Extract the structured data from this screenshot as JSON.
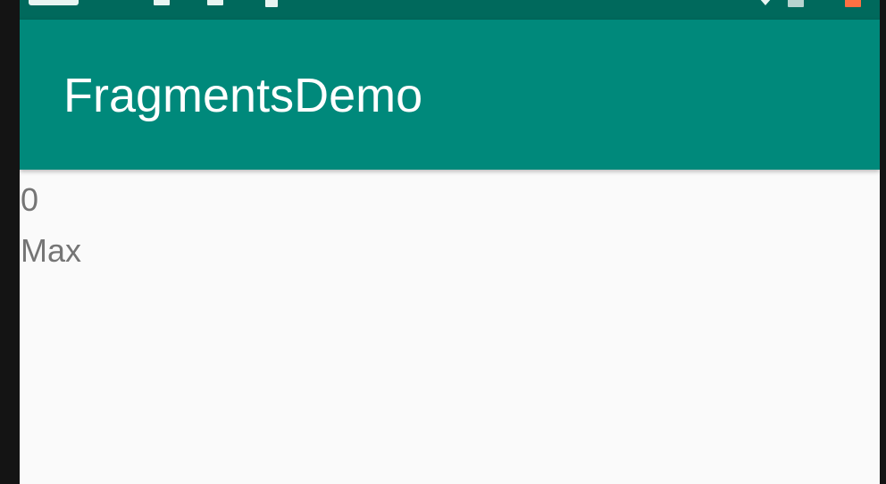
{
  "app_bar": {
    "title": "FragmentsDemo",
    "color": "#00897b"
  },
  "status_bar": {
    "color": "#00695c",
    "icons": [
      "time-icon",
      "notification-icon",
      "sd-card-icon",
      "clipboard-icon",
      "wifi-icon",
      "signal-icon",
      "battery-icon"
    ]
  },
  "content": {
    "counter_value": "0",
    "max_label": "Max"
  }
}
